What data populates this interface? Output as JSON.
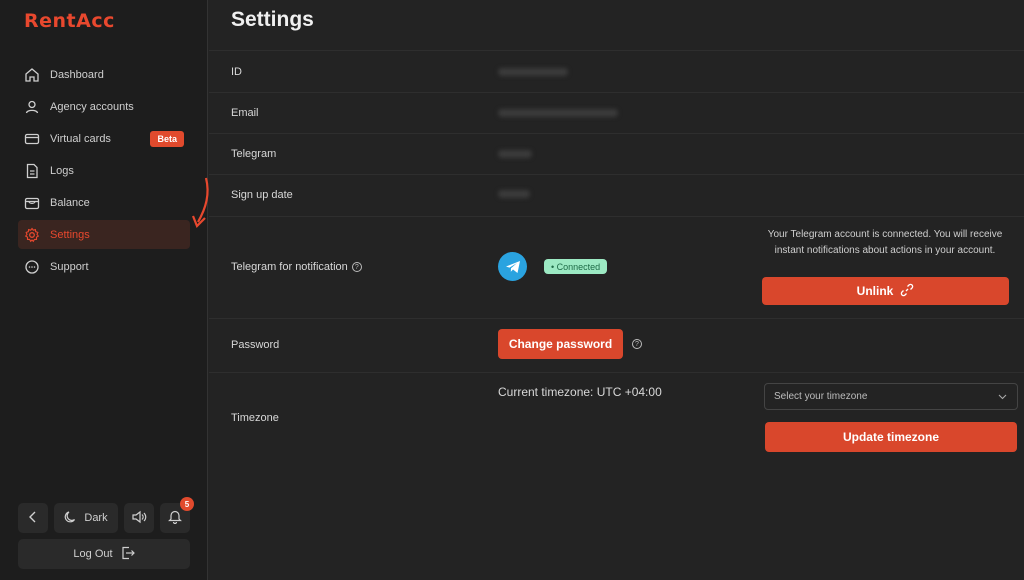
{
  "brand": {
    "logo_text": "RentAcc",
    "accent": "#e8482e"
  },
  "sidebar": {
    "items": [
      {
        "label": "Dashboard",
        "icon": "home-icon"
      },
      {
        "label": "Agency accounts",
        "icon": "user-icon"
      },
      {
        "label": "Virtual cards",
        "icon": "card-icon",
        "badge": "Beta"
      },
      {
        "label": "Logs",
        "icon": "document-icon"
      },
      {
        "label": "Balance",
        "icon": "wallet-icon"
      },
      {
        "label": "Settings",
        "icon": "gear-icon",
        "active": true
      },
      {
        "label": "Support",
        "icon": "chat-icon"
      }
    ],
    "theme_label": "Dark",
    "notification_count": "5",
    "logout_label": "Log Out"
  },
  "page": {
    "title": "Settings"
  },
  "fields": {
    "id_label": "ID",
    "email_label": "Email",
    "telegram_label": "Telegram",
    "signup_label": "Sign up date",
    "tg_notify_label": "Telegram for notification",
    "password_label": "Password",
    "timezone_label": "Timezone"
  },
  "telegram": {
    "status": "• Connected",
    "info": "Your Telegram account is connected. You will receive instant notifications about actions in your account.",
    "unlink_label": "Unlink"
  },
  "password": {
    "change_label": "Change password"
  },
  "timezone": {
    "current": "Current timezone: UTC +04:00",
    "placeholder": "Select your timezone",
    "update_label": "Update timezone"
  }
}
